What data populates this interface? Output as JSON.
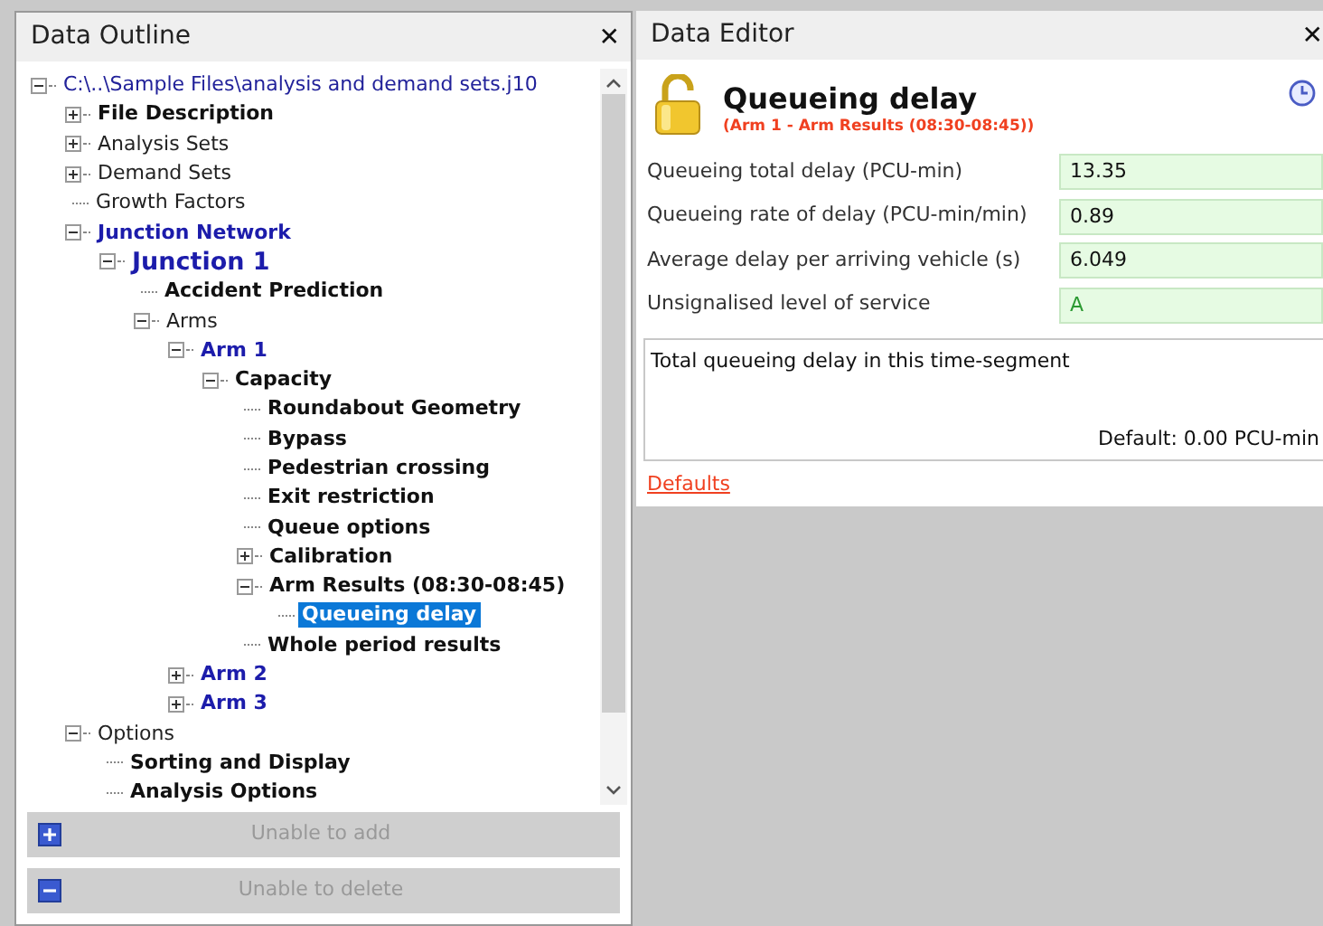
{
  "outline": {
    "title": "Data Outline",
    "close": "✕",
    "tree": [
      {
        "label": "C:\\..\\Sample Files\\analysis and demand sets.j10",
        "kind": "blue",
        "expanded": true,
        "selected": false,
        "children": [
          {
            "label": "File Description",
            "kind": "bold",
            "expanded": false,
            "selected": false
          },
          {
            "label": "Analysis Sets",
            "kind": "plain",
            "expanded": false,
            "selected": false
          },
          {
            "label": "Demand Sets",
            "kind": "plain",
            "expanded": false,
            "selected": false
          },
          {
            "label": "Growth Factors",
            "kind": "plain",
            "selected": false
          },
          {
            "label": "Junction Network",
            "kind": "bluebold",
            "expanded": true,
            "selected": false,
            "children": [
              {
                "label": "Junction 1",
                "kind": "bluelarge",
                "expanded": true,
                "selected": false,
                "children": [
                  {
                    "label": "Accident Prediction",
                    "kind": "bold",
                    "selected": false
                  },
                  {
                    "label": "Arms",
                    "kind": "plain",
                    "expanded": true,
                    "selected": false,
                    "children": [
                      {
                        "label": "Arm 1",
                        "kind": "bluebold",
                        "expanded": true,
                        "selected": false,
                        "children": [
                          {
                            "label": "Capacity",
                            "kind": "bold",
                            "expanded": true,
                            "selected": false,
                            "children": [
                              {
                                "label": "Roundabout Geometry",
                                "kind": "bold",
                                "selected": false
                              },
                              {
                                "label": "Bypass",
                                "kind": "bold",
                                "selected": false
                              },
                              {
                                "label": "Pedestrian crossing",
                                "kind": "bold",
                                "selected": false
                              },
                              {
                                "label": "Exit restriction",
                                "kind": "bold",
                                "selected": false
                              },
                              {
                                "label": "Queue options",
                                "kind": "bold",
                                "selected": false
                              },
                              {
                                "label": "Calibration",
                                "kind": "bold",
                                "expanded": false,
                                "selected": false
                              },
                              {
                                "label": "Arm Results (08:30-08:45)",
                                "kind": "bold",
                                "expanded": true,
                                "selected": false,
                                "children": [
                                  {
                                    "label": "Queueing delay",
                                    "kind": "bold",
                                    "selected": true
                                  }
                                ]
                              },
                              {
                                "label": "Whole period results",
                                "kind": "bold",
                                "selected": false
                              }
                            ]
                          }
                        ]
                      },
                      {
                        "label": "Arm 2",
                        "kind": "bluebold",
                        "expanded": false,
                        "selected": false
                      },
                      {
                        "label": "Arm 3",
                        "kind": "bluebold",
                        "expanded": false,
                        "selected": false
                      }
                    ]
                  }
                ]
              }
            ]
          },
          {
            "label": "Options",
            "kind": "plain",
            "expanded": true,
            "selected": false,
            "children": [
              {
                "label": "Sorting and Display",
                "kind": "bold",
                "selected": false
              },
              {
                "label": "Analysis Options",
                "kind": "bold",
                "selected": false
              }
            ]
          }
        ]
      }
    ],
    "buttons": [
      {
        "kind": "add",
        "label": "Unable to add",
        "disabled": true
      },
      {
        "kind": "delete",
        "label": "Unable to delete",
        "disabled": true
      }
    ]
  },
  "editor": {
    "title": "Data Editor",
    "close": "✕",
    "locked": false,
    "heading": "Queueing delay",
    "subheading": "(Arm 1 - Arm Results (08:30-08:45))",
    "fields": [
      {
        "label": "Queueing total delay (PCU-min)",
        "value": "13.35"
      },
      {
        "label": "Queueing rate of delay (PCU-min/min)",
        "value": "0.89"
      },
      {
        "label": "Average delay per arriving vehicle (s)",
        "value": "6.049"
      },
      {
        "label": "Unsignalised level of service",
        "value": "A",
        "kind": "grade"
      }
    ],
    "description": "Total queueing delay in this time-segment",
    "default": "Default: 0.00 PCU-min",
    "link": "Defaults"
  }
}
